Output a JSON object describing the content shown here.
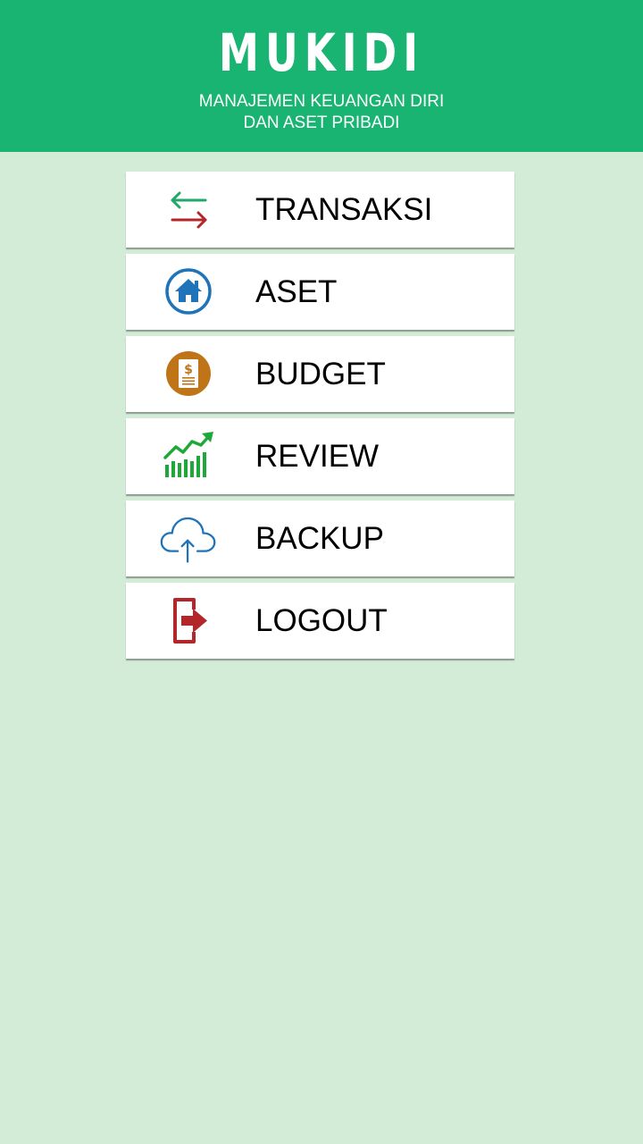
{
  "header": {
    "title": "MUKIDI",
    "subtitle_line1": "MANAJEMEN KEUANGAN DIRI",
    "subtitle_line2": "DAN ASET PRIBADI"
  },
  "colors": {
    "header_bg": "#1ab472",
    "page_bg": "#d3ecd8",
    "card_bg": "#ffffff",
    "transfer_left_arrow": "#1fa86a",
    "transfer_right_arrow": "#b3272b",
    "asset_blue": "#1e73b9",
    "budget_orange": "#c07418",
    "review_green": "#1fa83a",
    "backup_blue": "#1e73b9",
    "logout_red": "#b3272b"
  },
  "menu": {
    "items": [
      {
        "label": "TRANSAKSI",
        "icon": "transfer-arrows-icon"
      },
      {
        "label": "ASET",
        "icon": "house-icon"
      },
      {
        "label": "BUDGET",
        "icon": "budget-dollar-icon"
      },
      {
        "label": "REVIEW",
        "icon": "growth-chart-icon"
      },
      {
        "label": "BACKUP",
        "icon": "cloud-upload-icon"
      },
      {
        "label": "LOGOUT",
        "icon": "logout-icon"
      }
    ]
  }
}
